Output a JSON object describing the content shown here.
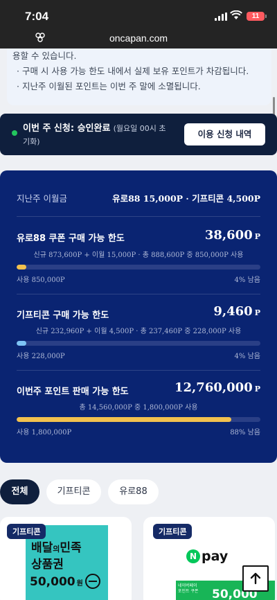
{
  "status_bar": {
    "time": "7:04",
    "battery": "11"
  },
  "browser": {
    "url": "oncapan.com"
  },
  "notice": {
    "lines": [
      "용할 수 있습니다.",
      "· 구매 시 사용 가능 한도 내에서 실제 보유 포인트가 차감됩니다.",
      "· 지난주 이월된 포인트는 이번 주 말에 소멸됩니다."
    ]
  },
  "application": {
    "status_label": "이번 주 신청: 승인완료",
    "status_note": "(월요일 00시 초기화)",
    "history_button": "이용 신청 내역"
  },
  "limits": {
    "last_week_label": "지난주 이월금",
    "last_week_values": "유로88 15,000P · 기프티콘 4,500P",
    "items": [
      {
        "title": "유로88 쿠폰 구매 가능 한도",
        "amount": "38,600",
        "unit": "P",
        "detail": "신규 873,600P + 이월 15,000P · 총 888,600P 중 850,000P 사용",
        "used": "사용 850,000P",
        "remaining": "4% 남음",
        "usage_fraction": 0.04,
        "bar_color": "#f2c14e"
      },
      {
        "title": "기프티콘 구매 가능 한도",
        "amount": "9,460",
        "unit": "P",
        "detail": "신규 232,960P + 이월 4,500P · 총 237,460P 중 228,000P 사용",
        "used": "사용 228,000P",
        "remaining": "4% 남음",
        "usage_fraction": 0.04,
        "bar_color": "#7ec4f5"
      },
      {
        "title": "이번주 포인트 판매 가능 한도",
        "amount": "12,760,000",
        "unit": "P",
        "detail": "총 14,560,000P 중 1,800,000P 사용",
        "used": "사용 1,800,000P",
        "remaining": "88% 남음",
        "usage_fraction": 0.88,
        "bar_color": "#f2c14e"
      }
    ]
  },
  "filters": {
    "all": "전체",
    "gifticon": "기프티콘",
    "euro88": "유로88"
  },
  "products": [
    {
      "badge": "기프티콘",
      "image_title_line1": "배달",
      "image_title_mid": "의",
      "image_title_line1_end": "민족",
      "image_title_line2": "상품권",
      "image_price": "50,000",
      "image_price_unit": "원"
    },
    {
      "badge": "기프티콘",
      "logo_n": "N",
      "logo_text": "pay",
      "image_small_line1": "네이버페이",
      "image_small_line2": "포인트 쿠폰",
      "image_price": "50,000"
    }
  ],
  "colors": {
    "card_bg": "#0a2472",
    "status_dot": "#22c55e",
    "dark_navy": "#0f1f3d"
  }
}
